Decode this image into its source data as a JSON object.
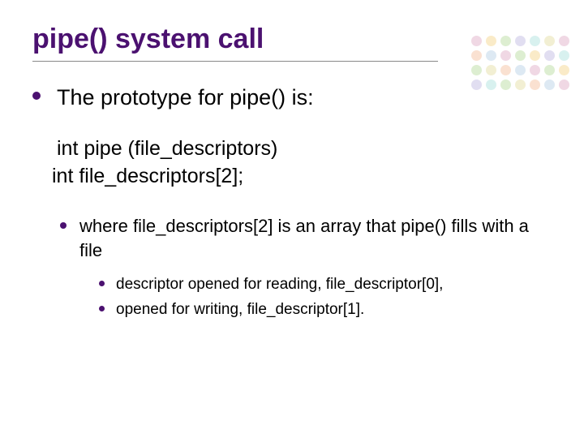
{
  "title": "pipe() system call",
  "bullets": {
    "l1_0": "The prototype for pipe() is:",
    "code_line1": "int pipe (file_descriptors)",
    "code_line2": "int file_descriptors[2];",
    "l2_0": "where file_descriptors[2] is an array that pipe() fills with a file",
    "l3_0": "descriptor opened for reading, file_descriptor[0],",
    "l3_1": "opened for writing, file_descriptor[1]."
  }
}
